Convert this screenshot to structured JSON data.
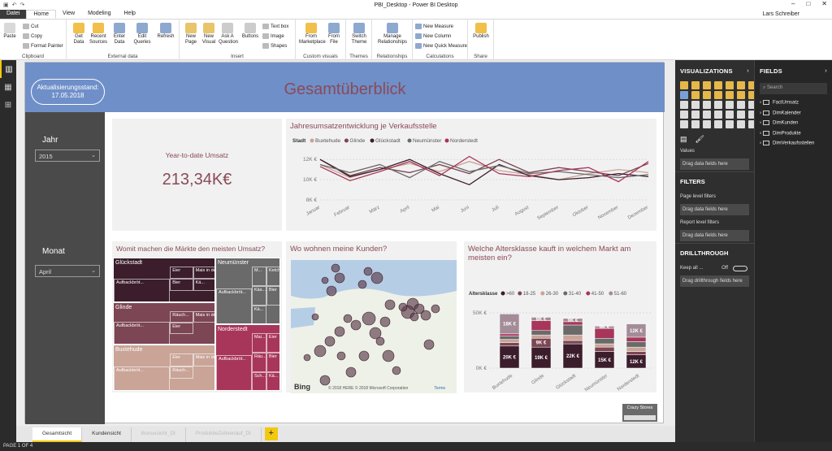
{
  "window": {
    "title": "PBI_Desktop - Power BI Desktop",
    "user": "Lars Schreiber"
  },
  "ribbon_tabs": [
    "Datei",
    "Home",
    "View",
    "Modeling",
    "Help"
  ],
  "ribbon": {
    "clipboard": {
      "paste": "Paste",
      "cut": "Cut",
      "copy": "Copy",
      "format_painter": "Format Painter",
      "group": "Clipboard"
    },
    "external": {
      "get_data": "Get Data",
      "recent": "Recent Sources",
      "enter": "Enter Data",
      "edit": "Edit Queries",
      "refresh": "Refresh",
      "group": "External data"
    },
    "insert": {
      "new_page": "New Page",
      "new_visual": "New Visual",
      "ask": "Ask A Question",
      "buttons": "Buttons",
      "text_box": "Text box",
      "image": "Image",
      "shapes": "Shapes",
      "group": "Insert"
    },
    "custom": {
      "marketplace": "From Marketplace",
      "file": "From File",
      "group": "Custom visuals"
    },
    "themes": {
      "switch": "Switch Theme",
      "group": "Themes"
    },
    "relationships": {
      "manage": "Manage Relationships",
      "group": "Relationships"
    },
    "calculations": {
      "measure": "New Measure",
      "column": "New Column",
      "quick": "New Quick Measure",
      "group": "Calculations"
    },
    "share": {
      "publish": "Publish",
      "group": "Share"
    }
  },
  "report": {
    "refresh_label": "Aktualisierungsstand:",
    "refresh_date": "17.05.2018",
    "title": "Gesamtüberblick",
    "jahr_label": "Jahr",
    "jahr_value": "2015",
    "monat_label": "Monat",
    "monat_value": "April",
    "kpi_title": "Year-to-date Umsatz",
    "kpi_value": "213,34K€",
    "treemap_title": "Womit machen die Märkte den meisten Umsatz?",
    "map_title": "Wo wohnen meine Kunden?",
    "map_credit": "© 2018 HERE © 2018 Microsoft Corporation",
    "map_terms": "Terms",
    "bing": "Bing",
    "age_title": "Welche Altersklasse kauft in welchem Markt am meisten ein?",
    "crazy_stores": "Crazy Stores"
  },
  "chart_data": [
    {
      "type": "line",
      "title": "Jahresumsatzentwicklung je Verkaufsstelle",
      "legend_title": "Stadt",
      "x": [
        "Januar",
        "Februar",
        "März",
        "April",
        "Mai",
        "Juni",
        "Juli",
        "August",
        "September",
        "Oktober",
        "November",
        "Dezember"
      ],
      "y_ticks": [
        "8K €",
        "10K €",
        "12K €"
      ],
      "ylim": [
        8000,
        12500
      ],
      "series": [
        {
          "name": "Buxtehude",
          "color": "#c9a497",
          "values": [
            11500,
            10200,
            11000,
            11600,
            10800,
            11800,
            10900,
            10500,
            10000,
            10600,
            11000,
            10700
          ]
        },
        {
          "name": "Glinde",
          "color": "#7c4654",
          "values": [
            12000,
            10400,
            11200,
            10700,
            11500,
            10600,
            12000,
            10700,
            11200,
            10800,
            10400,
            11600
          ]
        },
        {
          "name": "Glückstadt",
          "color": "#3b1d2b",
          "values": [
            12000,
            10300,
            11000,
            12000,
            10600,
            9500,
            11500,
            10400,
            10000,
            10200,
            10600,
            10300
          ]
        },
        {
          "name": "Neumünster",
          "color": "#6a6a6a",
          "values": [
            11500,
            10700,
            11500,
            10200,
            11800,
            10800,
            11400,
            10600,
            10800,
            10500,
            10200,
            10500
          ]
        },
        {
          "name": "Norderstedt",
          "color": "#a8365a",
          "values": [
            11300,
            9900,
            10800,
            11800,
            10400,
            12300,
            10600,
            10300,
            10900,
            11200,
            9800,
            11800
          ]
        }
      ]
    },
    {
      "type": "treemap",
      "groups": [
        {
          "name": "Glückstadt",
          "color": "#3b1d2b",
          "items": [
            "Aufbackbröt...",
            "Eier",
            "Mais in der D...",
            "Bier",
            "Kä..."
          ]
        },
        {
          "name": "Neumünster",
          "color": "#6a6a6a",
          "items": [
            "Aufbackbröt...",
            "M...",
            "Ketchup",
            "Käs...",
            "Bier",
            "Kä..."
          ]
        },
        {
          "name": "Glinde",
          "color": "#7c4654",
          "items": [
            "Aufbackbröt...",
            "Räuch...",
            "Mais in der D...",
            "Eier"
          ]
        },
        {
          "name": "Norderstedt",
          "color": "#a8365a",
          "items": [
            "Aufbackbröt...",
            "Mai...",
            "Eier",
            "Räu...",
            "Bier",
            "Sch...",
            "Kä..."
          ]
        },
        {
          "name": "Buxtehude",
          "color": "#c9a497",
          "items": [
            "Aufbackbröt...",
            "Eier",
            "Mais in der D...",
            "Räuch..."
          ]
        }
      ]
    },
    {
      "type": "bar",
      "stacked": true,
      "legend_title": "Altersklasse",
      "categories": [
        "Buxtehude",
        "Glinde",
        "Glückstadt",
        "Neumünster",
        "Norderstedt"
      ],
      "y_ticks": [
        "0K €",
        "50K €"
      ],
      "ylim": [
        0,
        50000
      ],
      "series": [
        {
          "name": ">60",
          "color": "#3b1d2b",
          "values": [
            20000,
            19000,
            22000,
            15000,
            12000
          ]
        },
        {
          "name": "18-25",
          "color": "#7c4654",
          "values": [
            3000,
            8000,
            3000,
            4000,
            3000
          ]
        },
        {
          "name": "26-30",
          "color": "#c9a497",
          "values": [
            3000,
            3000,
            5000,
            3000,
            4000
          ]
        },
        {
          "name": "31-40",
          "color": "#6a6a6a",
          "values": [
            3000,
            4000,
            9000,
            5000,
            5000
          ]
        },
        {
          "name": "41-50",
          "color": "#a8365a",
          "values": [
            2000,
            9000,
            3000,
            9000,
            4000
          ]
        },
        {
          "name": "51-60",
          "color": "#a38c98",
          "values": [
            18000,
            3000,
            3000,
            2000,
            12000
          ]
        }
      ],
      "data_labels": [
        {
          "category": "Buxtehude",
          "labels": [
            "20K €",
            "18K €"
          ]
        },
        {
          "category": "Glinde",
          "labels": [
            "19K €",
            "8K €",
            "9K €"
          ]
        },
        {
          "category": "Glückstadt",
          "labels": [
            "22K €",
            "9K €"
          ]
        },
        {
          "category": "Neumünster",
          "labels": [
            "15K €",
            "9K €"
          ]
        },
        {
          "category": "Norderstedt",
          "labels": [
            "12K €",
            "12K €"
          ]
        }
      ]
    }
  ],
  "page_tabs": [
    "Gesamtsicht",
    "Kundensicht",
    "Bonussicht_DI",
    "ProduktieZeitverlauf_DI"
  ],
  "status": "PAGE 1 OF 4",
  "visualizations": {
    "title": "VISUALIZATIONS",
    "values": "Values",
    "drag": "Drag data fields here"
  },
  "filters": {
    "title": "FILTERS",
    "page": "Page level filters",
    "report": "Report level filters",
    "drag": "Drag data fields here"
  },
  "drillthrough": {
    "title": "DRILLTHROUGH",
    "keep": "Keep all ...",
    "off": "Off",
    "drag": "Drag drillthrough fields here"
  },
  "fields": {
    "title": "FIELDS",
    "search": "Search",
    "tables": [
      "FactUmsatz",
      "DimKalender",
      "DimKunden",
      "DimProdukte",
      "DimVerkaufsstellen"
    ]
  }
}
